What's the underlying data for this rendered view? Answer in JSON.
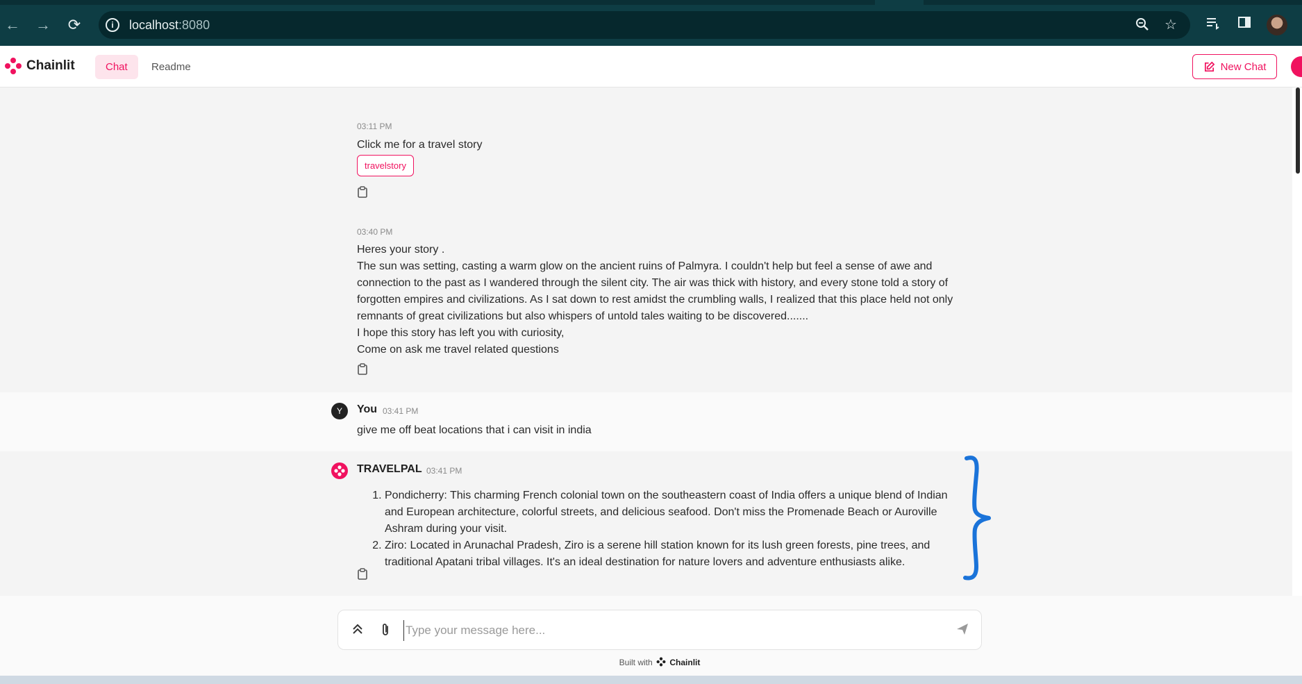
{
  "browser": {
    "url_host": "localhost",
    "url_port": ":8080"
  },
  "app": {
    "name": "Chainlit",
    "tabs": [
      {
        "label": "Chat",
        "active": true
      },
      {
        "label": "Readme",
        "active": false
      }
    ],
    "new_chat_label": "New Chat",
    "accent_color": "#f0125f"
  },
  "messages": [
    {
      "time": "03:11 PM",
      "text": "Click me for a travel story",
      "action_label": "travelstory"
    },
    {
      "time": "03:40 PM",
      "lines": [
        "Heres your story .",
        "The sun was setting, casting a warm glow on the ancient ruins of Palmyra. I couldn't help but feel a sense of awe and connection to the past as I wandered through the silent city. The air was thick with history, and every stone told a story of forgotten empires and civilizations. As I sat down to rest amidst the crumbling walls, I realized that this place held not only remnants of great civilizations but also whispers of untold tales waiting to be discovered.......",
        "I hope this story has left you with curiosity,",
        "Come on ask me travel related questions"
      ]
    },
    {
      "author": "You",
      "avatar_letter": "Y",
      "time": "03:41 PM",
      "text": "give me off beat locations that i can visit in india"
    },
    {
      "author": "TRAVELPAL",
      "time": "03:41 PM",
      "items": [
        "Pondicherry: This charming French colonial town on the southeastern coast of India offers a unique blend of Indian and European architecture, colorful streets, and delicious seafood. Don't miss the Promenade Beach or Auroville Ashram during your visit.",
        "Ziro: Located in Arunachal Pradesh, Ziro is a serene hill station known for its lush green forests, pine trees, and traditional Apatani tribal villages. It's an ideal destination for nature lovers and adventure enthusiasts alike."
      ]
    }
  ],
  "composer": {
    "placeholder": "Type your message here...",
    "built_with": "Built with",
    "built_with_brand": "Chainlit"
  }
}
